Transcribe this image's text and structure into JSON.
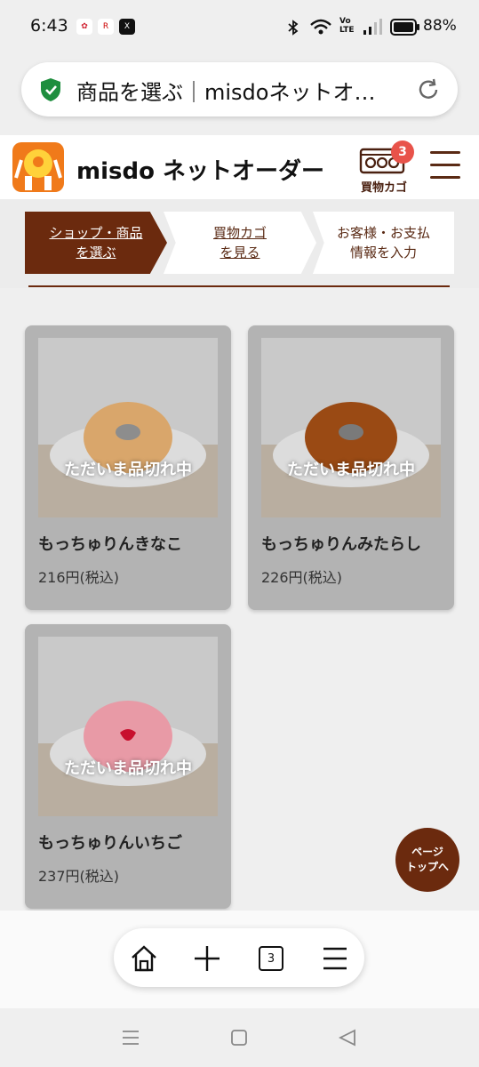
{
  "status_bar": {
    "time": "6:43",
    "battery_text": "88%"
  },
  "browser": {
    "url_text": "商品を選ぶ｜misdoネットオ…",
    "tab_count": "3"
  },
  "site": {
    "logo_text": "misdo ネットオーダー",
    "cart_label": "買物カゴ",
    "cart_count": "3"
  },
  "steps": [
    {
      "line1": "ショップ・商品",
      "line2": "を選ぶ"
    },
    {
      "line1": "買物カゴ",
      "line2": "を見る"
    },
    {
      "line1": "お客様・お支払",
      "line2": "情報を入力"
    }
  ],
  "products": [
    {
      "name": "もっちゅりんきなこ",
      "price": "216円(税込)",
      "status": "ただいま品切れ中",
      "donut_color": "#d9a66b"
    },
    {
      "name": "もっちゅりんみたらし",
      "price": "226円(税込)",
      "status": "ただいま品切れ中",
      "donut_color": "#9a4a14"
    },
    {
      "name": "もっちゅりんいちご",
      "price": "237円(税込)",
      "status": "ただいま品切れ中",
      "donut_color": "#e89aa6"
    }
  ],
  "page_top": {
    "line1": "ページ",
    "line2": "トップへ"
  },
  "colors": {
    "brand_brown": "#6b2a0e",
    "accent_orange": "#f07a1a",
    "badge_red": "#e8534a"
  }
}
